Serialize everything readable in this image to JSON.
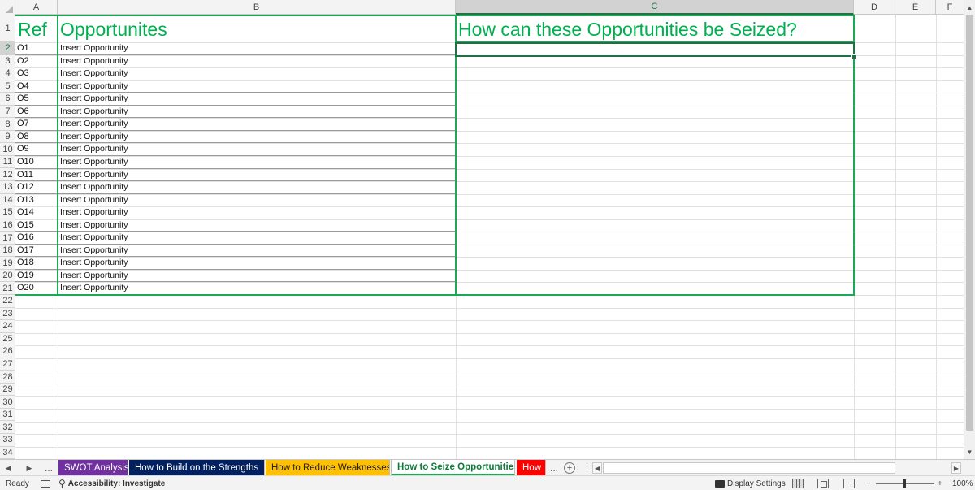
{
  "columns": [
    "A",
    "B",
    "C",
    "D",
    "E",
    "F"
  ],
  "headers": {
    "ref": "Ref",
    "opportunities": "Opportunites",
    "seize": "How can these Opportunities be Seized?"
  },
  "rows": [
    {
      "ref": "O1",
      "opportunity": "Insert Opportunity"
    },
    {
      "ref": "O2",
      "opportunity": "Insert Opportunity"
    },
    {
      "ref": "O3",
      "opportunity": "Insert Opportunity"
    },
    {
      "ref": "O4",
      "opportunity": "Insert Opportunity"
    },
    {
      "ref": "O5",
      "opportunity": "Insert Opportunity"
    },
    {
      "ref": "O6",
      "opportunity": "Insert Opportunity"
    },
    {
      "ref": "O7",
      "opportunity": "Insert Opportunity"
    },
    {
      "ref": "O8",
      "opportunity": "Insert Opportunity"
    },
    {
      "ref": "O9",
      "opportunity": "Insert Opportunity"
    },
    {
      "ref": "O10",
      "opportunity": "Insert Opportunity"
    },
    {
      "ref": "O11",
      "opportunity": "Insert Opportunity"
    },
    {
      "ref": "O12",
      "opportunity": "Insert Opportunity"
    },
    {
      "ref": "O13",
      "opportunity": "Insert Opportunity"
    },
    {
      "ref": "O14",
      "opportunity": "Insert Opportunity"
    },
    {
      "ref": "O15",
      "opportunity": "Insert Opportunity"
    },
    {
      "ref": "O16",
      "opportunity": "Insert Opportunity"
    },
    {
      "ref": "O17",
      "opportunity": "Insert Opportunity"
    },
    {
      "ref": "O18",
      "opportunity": "Insert Opportunity"
    },
    {
      "ref": "O19",
      "opportunity": "Insert Opportunity"
    },
    {
      "ref": "O20",
      "opportunity": "Insert Opportunity"
    }
  ],
  "row_numbers": [
    "1",
    "2",
    "3",
    "4",
    "5",
    "6",
    "7",
    "8",
    "9",
    "10",
    "11",
    "12",
    "13",
    "14",
    "15",
    "16",
    "17",
    "18",
    "19",
    "20",
    "21",
    "22",
    "23",
    "24",
    "25",
    "26",
    "27",
    "28",
    "29",
    "30",
    "31",
    "32",
    "33",
    "34"
  ],
  "selected_column": "C",
  "selected_row": "2",
  "tabs": {
    "ellipsis": "...",
    "swot": "SWOT Analysis",
    "strengths": "How to Build on the Strengths",
    "weaknesses": "How to Reduce Weaknesses",
    "opportunities": "How to Seize Opportunities",
    "threats_truncated": "How",
    "more": "...",
    "add": "+",
    "split": "⋮"
  },
  "tab_colors": {
    "swot": "#7030a0",
    "strengths": "#002060",
    "weaknesses": "#ffc000",
    "threats": "#ff0000",
    "accent": "#1ea855"
  },
  "status": {
    "ready": "Ready",
    "accessibility": "Accessibility: Investigate",
    "display_settings": "Display Settings",
    "zoom_minus": "−",
    "zoom_plus": "+",
    "zoom": "100%"
  },
  "icons": {
    "macro": "macro-recording-icon",
    "accessibility": "accessibility-icon",
    "display": "display-settings-icon"
  }
}
